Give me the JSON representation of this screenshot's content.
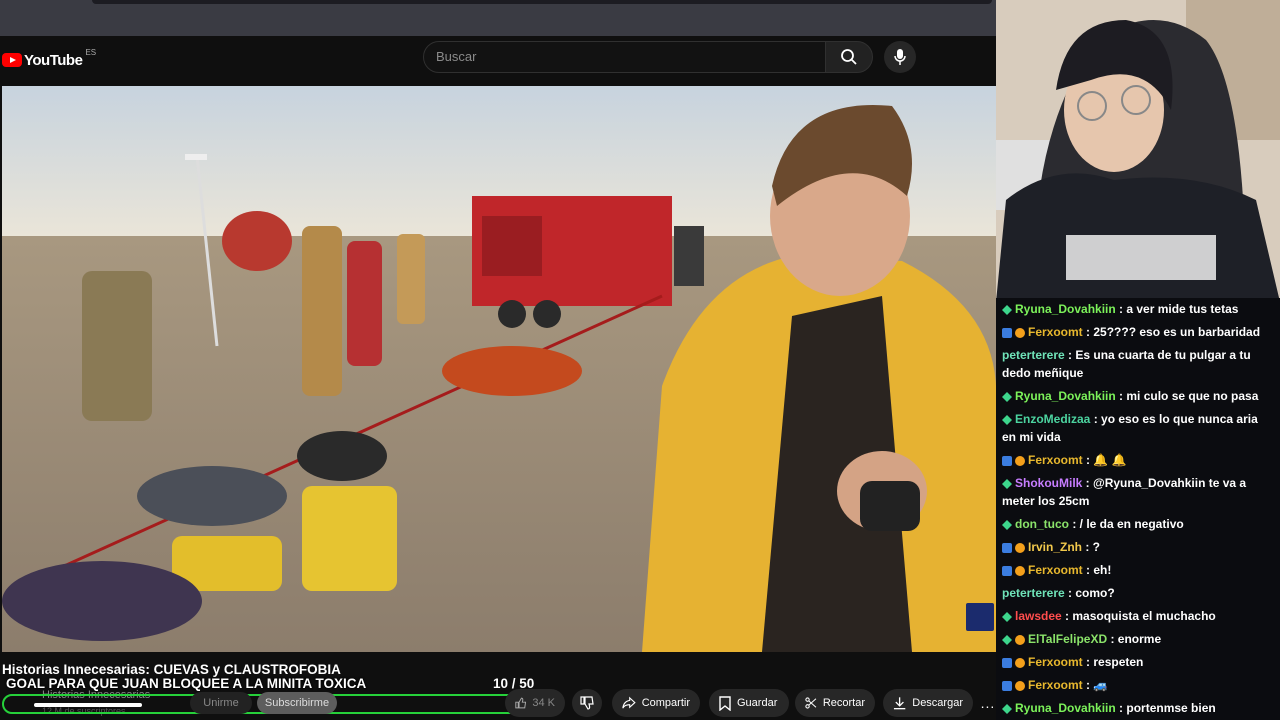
{
  "youtube": {
    "logo_text": "YouTube",
    "logo_country": "ES",
    "search_placeholder": "Buscar"
  },
  "video": {
    "title": "Historias Innecesarias: CUEVAS y CLAUSTROFOBIA",
    "channel_name": "Historias Innecesarias",
    "channel_subs": "12 M de suscriptores",
    "join_label": "Unirme",
    "subscribe_label": "Subscribirme",
    "likes": "34 K",
    "share_label": "Compartir",
    "save_label": "Guardar",
    "clip_label": "Recortar",
    "download_label": "Descargar",
    "more_label": "..."
  },
  "goal": {
    "text": "GOAL PARA QUE JUAN BLOQUEE A LA MINITA TOXICA",
    "current": 10,
    "target": 50,
    "count_label": "10  / 50"
  },
  "chat": {
    "messages": [
      {
        "user": "Ryuna_Dovahkiin",
        "text": " : a ver mide tus tetas",
        "color": "#7cf25a",
        "badges": [
          "green"
        ]
      },
      {
        "user": "Ferxoomt",
        "text": " : 25???? eso es un barbaridad",
        "color": "#e8b82e",
        "badges": [
          "blue",
          "gold"
        ]
      },
      {
        "user": "peterterere",
        "text": " : Es una cuarta de tu pulgar a tu dedo meñique",
        "color": "#6fe3b8",
        "badges": []
      },
      {
        "user": "Ryuna_Dovahkiin",
        "text": " : mi culo se que no pasa",
        "color": "#7cf25a",
        "badges": [
          "green"
        ]
      },
      {
        "user": "EnzoMedizaa",
        "text": " : yo eso es lo que nunca aria en mi vida",
        "color": "#4cd4a0",
        "badges": [
          "green"
        ]
      },
      {
        "user": "Ferxoomt",
        "text": " :  🔔  🔔",
        "color": "#e8b82e",
        "badges": [
          "blue",
          "gold"
        ]
      },
      {
        "user": "ShokouMilk",
        "text": " : @Ryuna_Dovahkiin te va a meter los 25cm",
        "color": "#c77dff",
        "badges": [
          "green"
        ]
      },
      {
        "user": "don_tuco",
        "text": " : / le da en negativo",
        "color": "#8be36a",
        "badges": [
          "green"
        ]
      },
      {
        "user": "Irvin_Znh",
        "text": " : ?",
        "color": "#f2c94c",
        "badges": [
          "blue",
          "gold"
        ]
      },
      {
        "user": "Ferxoomt",
        "text": " : eh!",
        "color": "#e8b82e",
        "badges": [
          "blue",
          "gold"
        ]
      },
      {
        "user": "peterterere",
        "text": " : como?",
        "color": "#6fe3b8",
        "badges": []
      },
      {
        "user": "lawsdee",
        "text": " : masoquista el muchacho",
        "color": "#ff4d4d",
        "badges": [
          "green"
        ]
      },
      {
        "user": "ElTalFelipeXD",
        "text": " : enorme",
        "color": "#8be36a",
        "badges": [
          "green",
          "gold"
        ]
      },
      {
        "user": "Ferxoomt",
        "text": " : respeten",
        "color": "#e8b82e",
        "badges": [
          "blue",
          "gold"
        ]
      },
      {
        "user": "Ferxoomt",
        "text": " : 🚙",
        "color": "#e8b82e",
        "badges": [
          "blue",
          "gold"
        ]
      },
      {
        "user": "Ryuna_Dovahkiin",
        "text": " : portenmse bien",
        "color": "#7cf25a",
        "badges": [
          "green"
        ]
      }
    ]
  }
}
